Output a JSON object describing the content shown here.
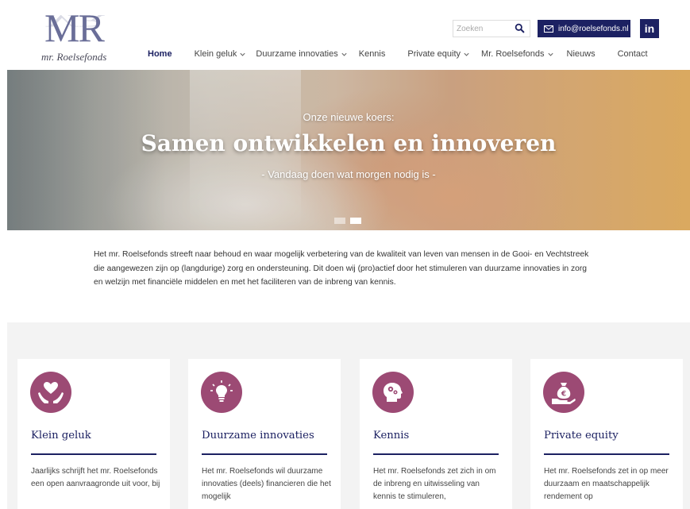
{
  "brand": {
    "logo_mark": "MR",
    "logo_text": "mr. Roelsefonds"
  },
  "header": {
    "search_placeholder": "Zoeken",
    "email_label": "info@roelsefonds.nl",
    "linkedin_label": "in"
  },
  "nav": {
    "items": [
      {
        "label": "Home",
        "active": true,
        "dropdown": false
      },
      {
        "label": "Klein geluk",
        "active": false,
        "dropdown": true
      },
      {
        "label": "Duurzame innovaties",
        "active": false,
        "dropdown": true
      },
      {
        "label": "Kennis",
        "active": false,
        "dropdown": false
      },
      {
        "label": "Private equity",
        "active": false,
        "dropdown": true
      },
      {
        "label": "Mr. Roelsefonds",
        "active": false,
        "dropdown": true
      },
      {
        "label": "Nieuws",
        "active": false,
        "dropdown": false
      },
      {
        "label": "Contact",
        "active": false,
        "dropdown": false
      }
    ]
  },
  "hero": {
    "kicker": "Onze nieuwe koers:",
    "title": "Samen ontwikkelen en innoveren",
    "subtitle": "- Vandaag doen wat morgen nodig is -"
  },
  "intro": {
    "text": "Het mr. Roelsefonds streeft naar behoud en waar mogelijk verbetering van de kwaliteit van leven van mensen in de Gooi- en Vechtstreek die aangewezen zijn op (langdurige) zorg en ondersteuning. Dit doen wij (pro)actief door het stimuleren van duurzame innovaties in zorg en welzijn met financiële middelen en met het faciliteren van de inbreng van kennis."
  },
  "cards": [
    {
      "icon": "heart-hands-icon",
      "title": "Klein geluk",
      "text": "Jaarlijks schrijft het mr. Roelsefonds een open aanvraagronde uit voor, bij"
    },
    {
      "icon": "lightbulb-icon",
      "title": "Duurzame innovaties",
      "text": "Het mr. Roelsefonds wil duurzame innovaties (deels) financieren die het mogelijk"
    },
    {
      "icon": "brain-gears-icon",
      "title": "Kennis",
      "text": "Het mr. Roelsefonds zet zich in om de inbreng en uitwisseling van kennis te stimuleren,"
    },
    {
      "icon": "money-bag-icon",
      "title": "Private equity",
      "text": "Het mr. Roelsefonds zet in op meer duurzaam en maatschappelijk rendement op"
    }
  ],
  "colors": {
    "navy": "#1c2162",
    "plum": "#9c4a74"
  }
}
